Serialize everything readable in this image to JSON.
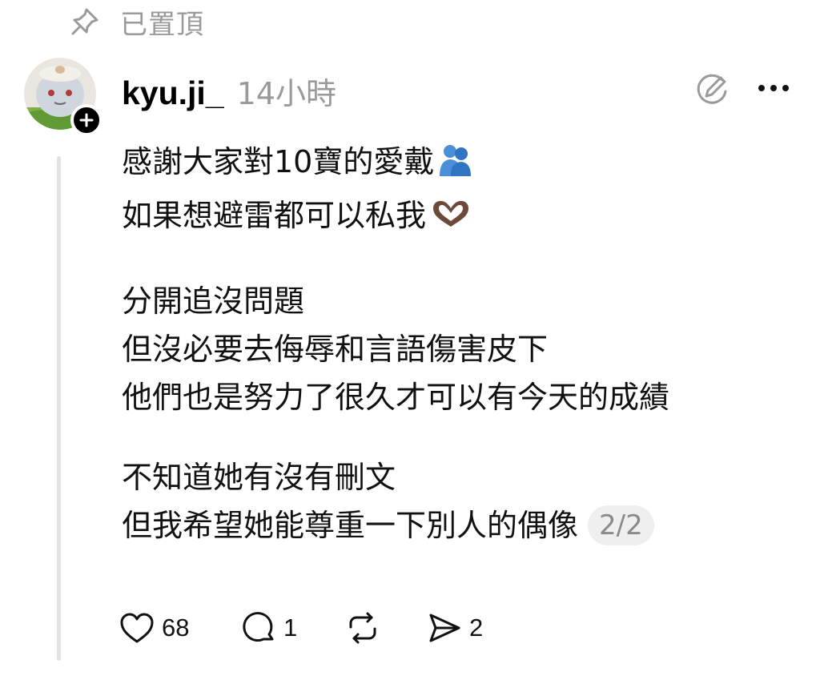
{
  "pinned": {
    "label": "已置頂",
    "icon": "pin-icon"
  },
  "post": {
    "username": "kyu.ji_",
    "time": "14小時",
    "avatar_icon": "avatar-image",
    "follow_icon": "plus-icon",
    "edit_icon": "edit-icon",
    "more_icon": "more-icon",
    "lines": {
      "l1": "感謝大家對10寶的愛戴",
      "l2": "如果想避雷都可以私我",
      "l3": "分開追沒問題",
      "l4": "但沒必要去侮辱和言語傷害皮下",
      "l5": "他們也是努力了很久才可以有今天的成績",
      "l6": "不知道她有沒有刪文",
      "l7": "但我希望她能尊重一下別人的偶像"
    },
    "emoji_1": "people-hugging-emoji",
    "emoji_2": "heart-hands-emoji",
    "page_indicator": "2/2"
  },
  "actions": {
    "like_count": "68",
    "reply_count": "1",
    "share_count": "2",
    "like_icon": "heart-icon",
    "reply_icon": "comment-icon",
    "repost_icon": "repost-icon",
    "share_icon": "send-icon"
  },
  "colors": {
    "muted_text": "#9a9a9a",
    "thread_line": "#e3e3e3",
    "pill_bg": "#efefef"
  }
}
